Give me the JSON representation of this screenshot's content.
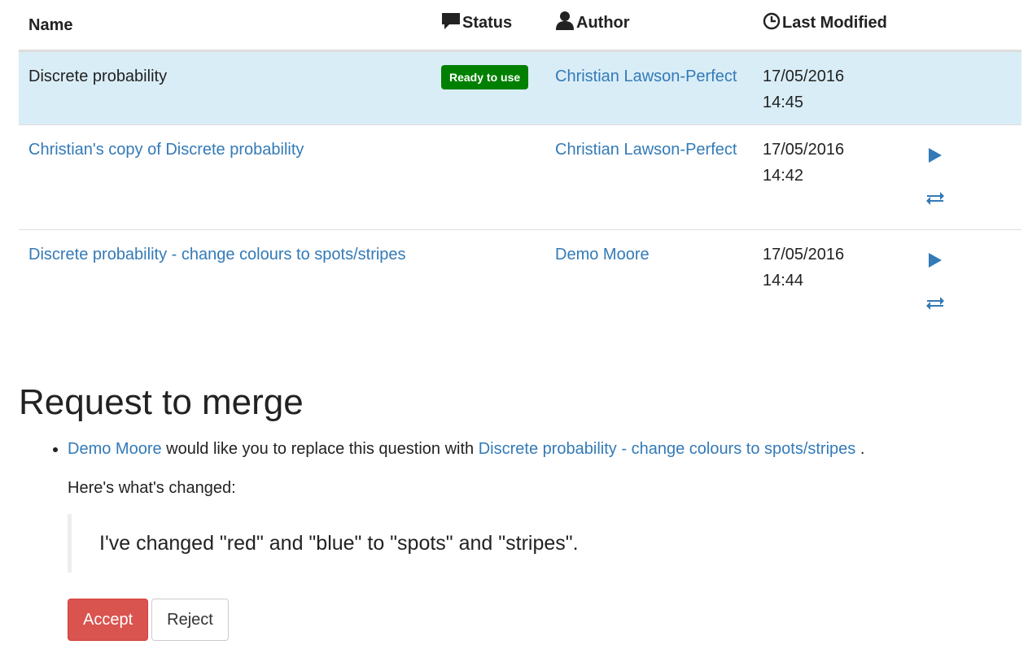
{
  "table": {
    "headers": {
      "name": "Name",
      "status": "Status",
      "author": "Author",
      "modified": "Last Modified"
    },
    "rows": [
      {
        "name": "Discrete probability",
        "status": "Ready to use",
        "author": "Christian Lawson-Perfect",
        "date": "17/05/2016",
        "time": "14:45"
      },
      {
        "name": "Christian's copy of Discrete probability",
        "status": "",
        "author": "Christian Lawson-Perfect",
        "date": "17/05/2016",
        "time": "14:42"
      },
      {
        "name": "Discrete probability - change colours to spots/stripes",
        "status": "",
        "author": "Demo Moore",
        "date": "17/05/2016",
        "time": "14:44"
      }
    ]
  },
  "merge": {
    "title": "Request to merge",
    "requester": "Demo Moore",
    "text_middle": "would like you to replace this question with",
    "target": "Discrete probability - change colours to spots/stripes",
    "text_end": ".",
    "changed_label": "Here's what's changed:",
    "message": "I've changed \"red\" and \"blue\" to \"spots\" and \"stripes\".",
    "accept_label": "Accept",
    "reject_label": "Reject"
  },
  "colors": {
    "link": "#337ab7",
    "current_row_bg": "#d9edf7",
    "badge_green": "#008000",
    "accept_red": "#d9534f"
  },
  "icons": [
    "comment-icon",
    "user-icon",
    "clock-icon",
    "play-icon",
    "transfer-icon"
  ]
}
